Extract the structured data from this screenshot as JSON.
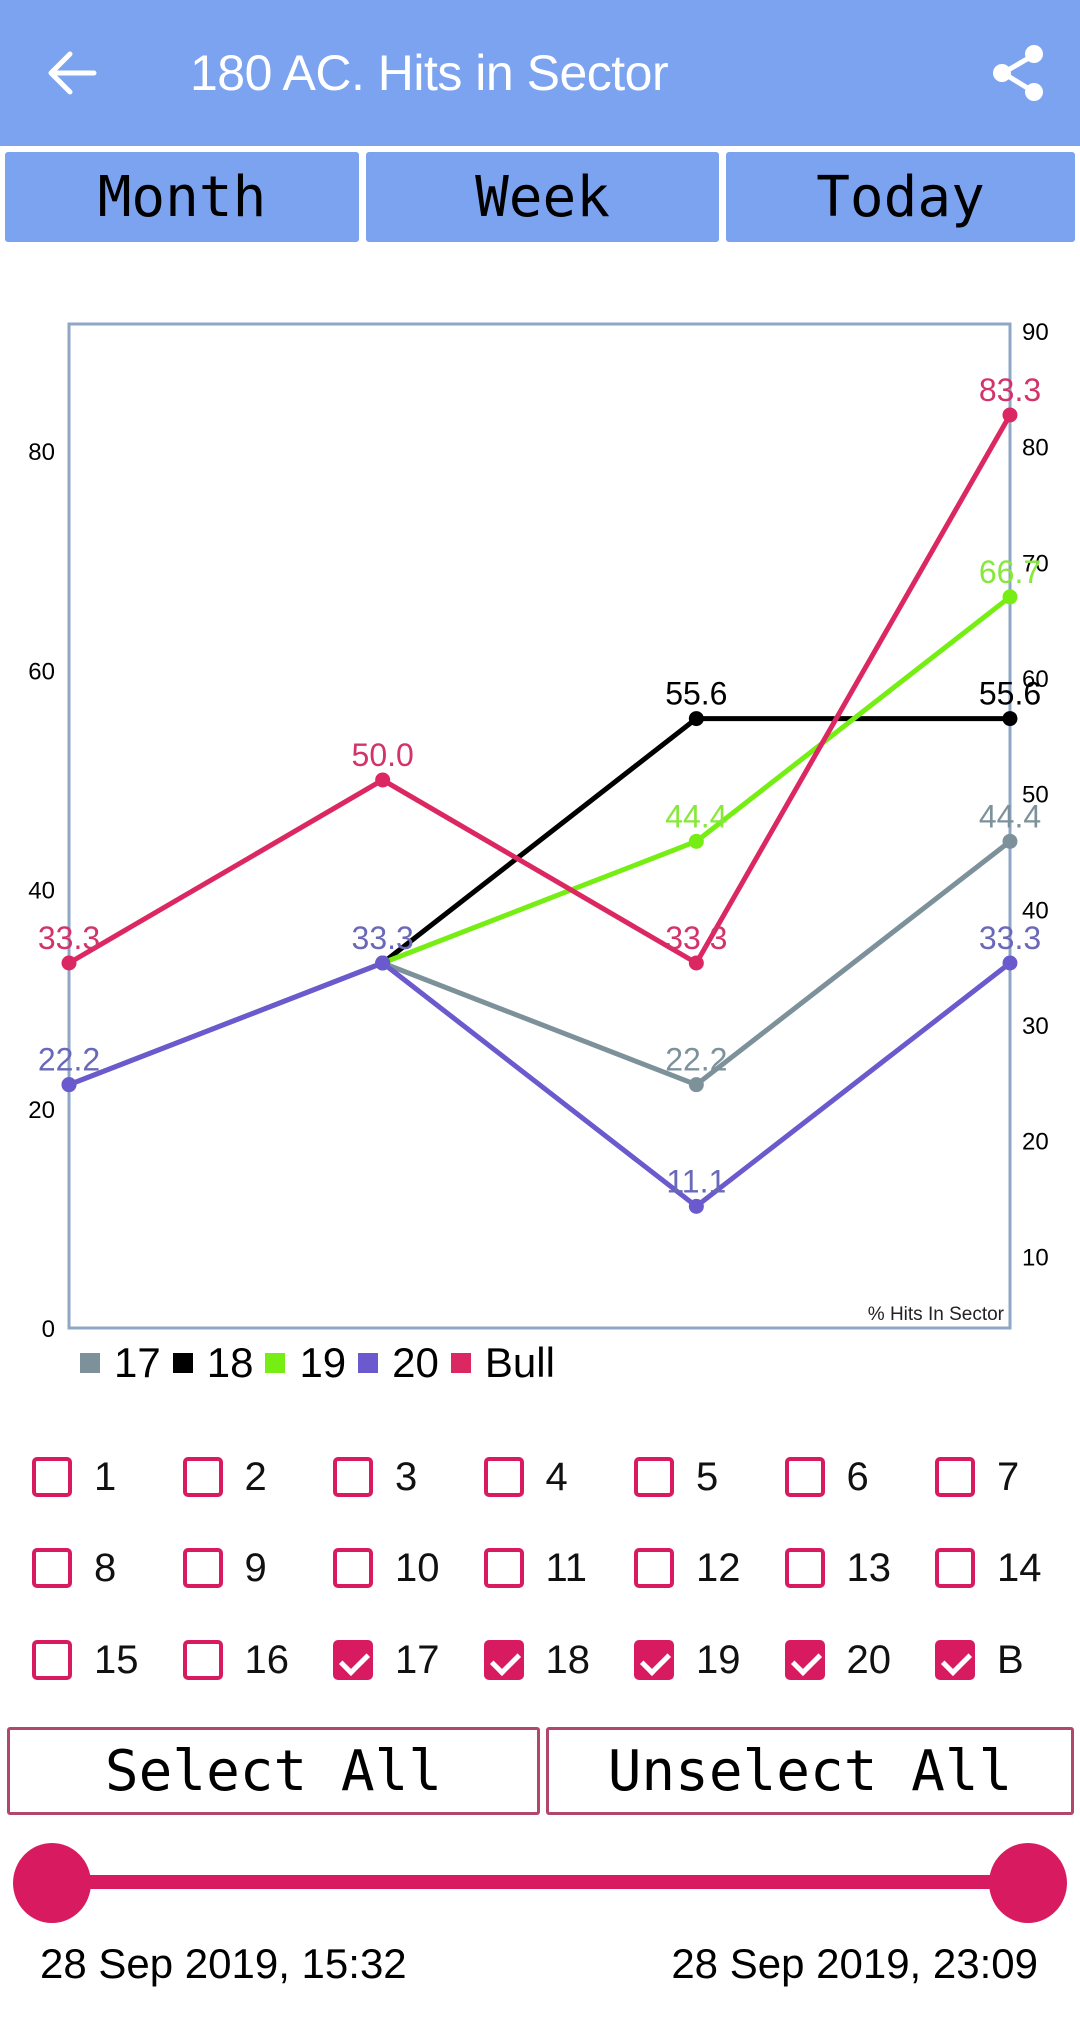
{
  "appbar": {
    "title": "180 AC. Hits in Sector",
    "back_icon": "arrow-left-icon",
    "share_icon": "share-icon",
    "color": "#7ca3ef"
  },
  "tabs": [
    {
      "label": "Month"
    },
    {
      "label": "Week"
    },
    {
      "label": "Today"
    }
  ],
  "chart_data": {
    "type": "line",
    "x": [
      0,
      1,
      2,
      3
    ],
    "series": [
      {
        "name": "17",
        "color": "#7d919b",
        "values": [
          22.2,
          33.3,
          22.2,
          44.4
        ]
      },
      {
        "name": "18",
        "color": "#000000",
        "values": [
          null,
          33.3,
          55.6,
          55.6
        ]
      },
      {
        "name": "19",
        "color": "#76ee14",
        "values": [
          null,
          33.3,
          44.4,
          66.7
        ]
      },
      {
        "name": "20",
        "color": "#6a5acd",
        "values": [
          22.2,
          33.3,
          11.1,
          33.3
        ]
      },
      {
        "name": "Bull",
        "color": "#dc2862",
        "values": [
          33.3,
          50.0,
          33.3,
          83.3
        ]
      }
    ],
    "data_labels": [
      {
        "series": "Bull",
        "text": "33.3",
        "x": 0,
        "y": 33.3
      },
      {
        "series": "20",
        "text": "22.2",
        "x": 0,
        "y": 22.2
      },
      {
        "series": "Bull",
        "text": "50.0",
        "x": 1,
        "y": 50.0
      },
      {
        "series": "20",
        "text": "33.3",
        "x": 1,
        "y": 33.3
      },
      {
        "series": "18",
        "text": "55.6",
        "x": 2,
        "y": 55.6
      },
      {
        "series": "19",
        "text": "44.4",
        "x": 2,
        "y": 44.4
      },
      {
        "series": "Bull",
        "text": "33.3",
        "x": 2,
        "y": 33.3
      },
      {
        "series": "17",
        "text": "22.2",
        "x": 2,
        "y": 22.2
      },
      {
        "series": "20",
        "text": "11.1",
        "x": 2,
        "y": 11.1
      },
      {
        "series": "Bull",
        "text": "83.3",
        "x": 3,
        "y": 83.3
      },
      {
        "series": "19",
        "text": "66.7",
        "x": 3,
        "y": 66.7
      },
      {
        "series": "18",
        "text": "55.6",
        "x": 3,
        "y": 55.6
      },
      {
        "series": "17",
        "text": "44.4",
        "x": 3,
        "y": 44.4
      },
      {
        "series": "20",
        "text": "33.3",
        "x": 3,
        "y": 33.3
      }
    ],
    "left_axis": {
      "ticks": [
        "0",
        "20",
        "40",
        "60",
        "80"
      ],
      "tick_values": [
        0,
        20,
        40,
        60,
        80
      ],
      "range": [
        0,
        91.6
      ]
    },
    "right_axis": {
      "ticks": [
        "10",
        "20",
        "30",
        "40",
        "50",
        "60",
        "70",
        "80",
        "90"
      ],
      "tick_values": [
        10,
        20,
        30,
        40,
        50,
        60,
        70,
        80,
        90
      ],
      "range": [
        3.8,
        90.6
      ]
    },
    "title": "",
    "xlabel": "",
    "ylabel": "% Hits In Sector",
    "grid": false,
    "legend_position": "bottom-left",
    "legend": [
      "17",
      "18",
      "19",
      "20",
      "Bull"
    ]
  },
  "sectors": {
    "items": [
      {
        "label": "1",
        "checked": false
      },
      {
        "label": "2",
        "checked": false
      },
      {
        "label": "3",
        "checked": false
      },
      {
        "label": "4",
        "checked": false
      },
      {
        "label": "5",
        "checked": false
      },
      {
        "label": "6",
        "checked": false
      },
      {
        "label": "7",
        "checked": false
      },
      {
        "label": "8",
        "checked": false
      },
      {
        "label": "9",
        "checked": false
      },
      {
        "label": "10",
        "checked": false
      },
      {
        "label": "11",
        "checked": false
      },
      {
        "label": "12",
        "checked": false
      },
      {
        "label": "13",
        "checked": false
      },
      {
        "label": "14",
        "checked": false
      },
      {
        "label": "15",
        "checked": false
      },
      {
        "label": "16",
        "checked": false
      },
      {
        "label": "17",
        "checked": true
      },
      {
        "label": "18",
        "checked": true
      },
      {
        "label": "19",
        "checked": true
      },
      {
        "label": "20",
        "checked": true
      },
      {
        "label": "B",
        "checked": true
      }
    ],
    "accent": "#d81b60"
  },
  "buttons": {
    "select_all": "Select All",
    "unselect_all": "Unselect All"
  },
  "range": {
    "start": "28 Sep 2019, 15:32",
    "end": "28 Sep 2019, 23:09",
    "start_fraction": 0,
    "end_fraction": 1
  }
}
